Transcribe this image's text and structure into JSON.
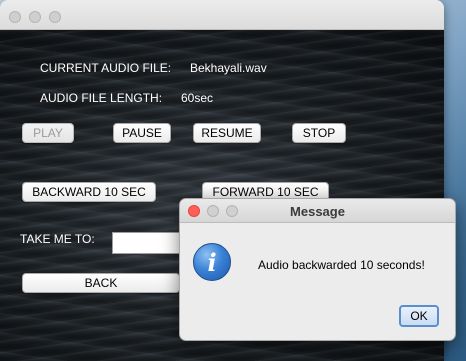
{
  "main_window": {
    "current_file_label": "CURRENT AUDIO FILE:",
    "current_file_value": "Bekhayali.wav",
    "length_label": "AUDIO FILE LENGTH:",
    "length_value": "60sec",
    "buttons": {
      "play": "PLAY",
      "pause": "PAUSE",
      "resume": "RESUME",
      "stop": "STOP",
      "backward": "BACKWARD 10 SEC",
      "forward": "FORWARD 10 SEC",
      "back": "BACK"
    },
    "take_me_to_label": "TAKE ME TO:",
    "take_me_to_value": ""
  },
  "dialog": {
    "title": "Message",
    "icon": "info-icon",
    "icon_glyph": "i",
    "message": "Audio backwarded 10 seconds!",
    "ok_label": "OK"
  },
  "colors": {
    "close": "#ff5f57",
    "minimize": "#febc2e",
    "zoom": "#28c840",
    "info_blue": "#3b82d6"
  }
}
